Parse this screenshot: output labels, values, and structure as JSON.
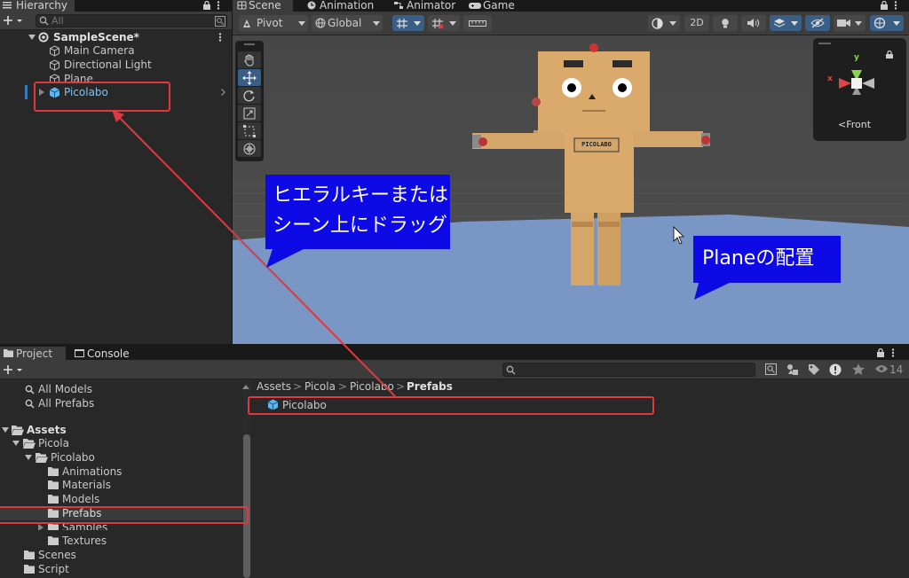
{
  "hierarchy": {
    "tab": "Hierarchy",
    "search_placeholder": "All",
    "scene_name": "SampleScene*",
    "items": [
      {
        "label": "Main Camera"
      },
      {
        "label": "Directional Light"
      },
      {
        "label": "Plane"
      },
      {
        "label": "Picolabo"
      }
    ]
  },
  "scene_view": {
    "tabs": [
      "Scene",
      "Animation",
      "Animator",
      "Game"
    ],
    "pivot": "Pivot",
    "global": "Global",
    "mode_2d": "2D",
    "gizmo_label": "<Front",
    "gizmo_axis_x": "x",
    "gizmo_axis_y": "y",
    "sign_text": "PICOLABO",
    "callout_drag": [
      "ヒエラルキーまたは",
      "シーン上にドラッグ"
    ],
    "callout_plane": "Planeの配置"
  },
  "project": {
    "tabs": [
      "Project",
      "Console"
    ],
    "favorites": [
      "All Models",
      "All Prefabs"
    ],
    "tree": [
      {
        "label": "Assets"
      },
      {
        "label": "Picola"
      },
      {
        "label": "Picolabo"
      },
      {
        "label": "Animations"
      },
      {
        "label": "Materials"
      },
      {
        "label": "Models"
      },
      {
        "label": "Prefabs"
      },
      {
        "label": "Samples"
      },
      {
        "label": "Textures"
      },
      {
        "label": "Scenes"
      },
      {
        "label": "Script"
      }
    ],
    "breadcrumb": [
      "Assets",
      "Picola",
      "Picolabo",
      "Prefabs"
    ],
    "breadcrumb_sep": ">",
    "asset": "Picolabo",
    "visible_count": "14"
  },
  "colors": {
    "highlight_red": "#e0383e",
    "callout_blue": "#0d0ae6",
    "prefab_blue": "#5fb6f0",
    "plane_blue": "#7996c4"
  }
}
